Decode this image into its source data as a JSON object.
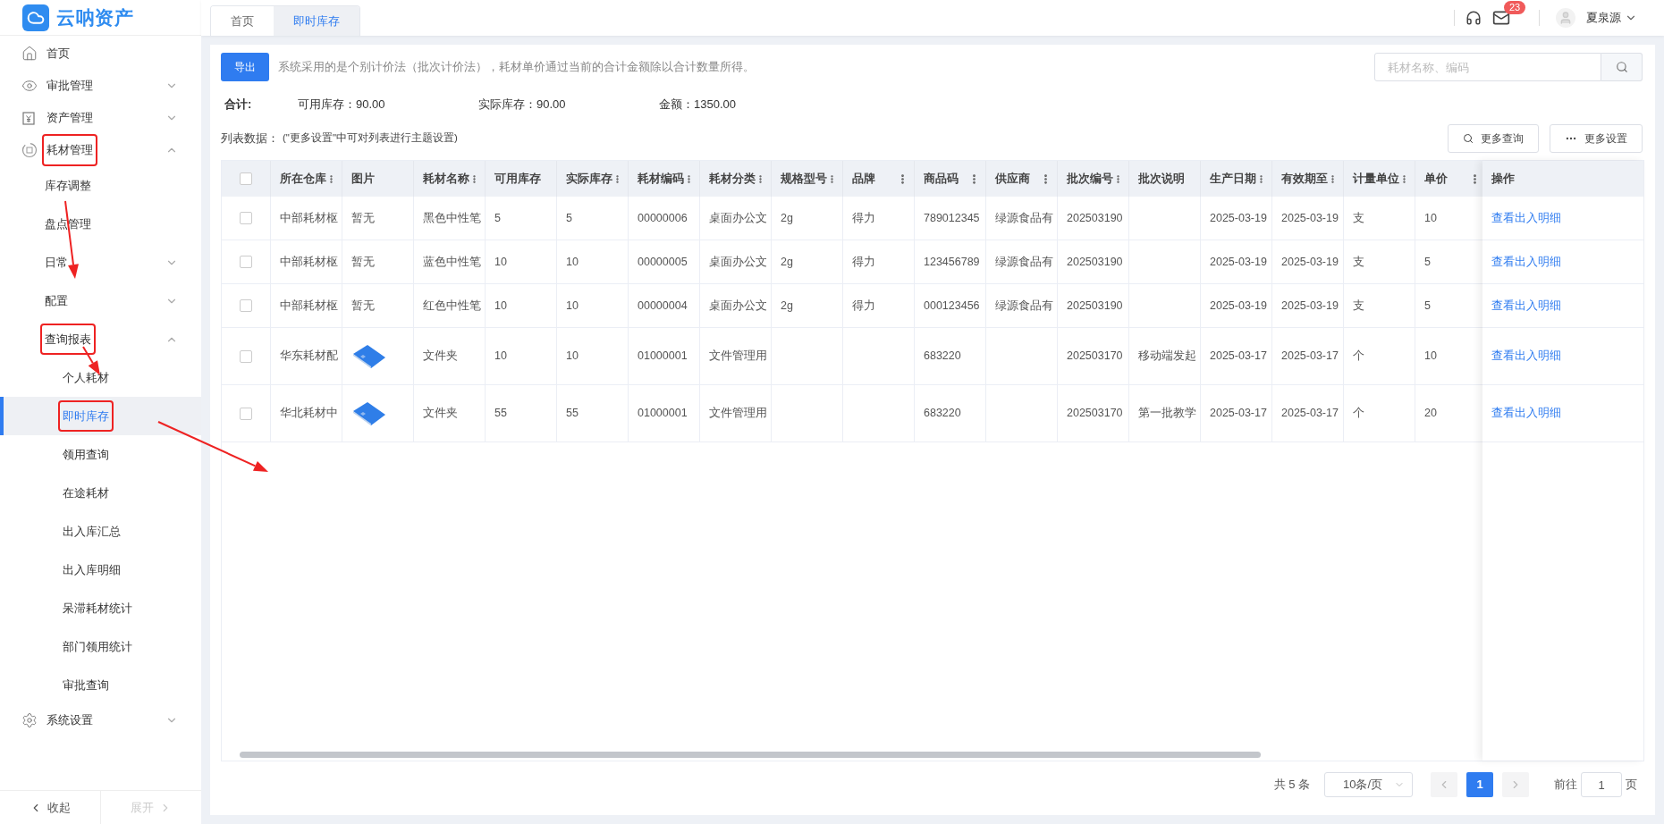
{
  "app": {
    "name": "云呐资产"
  },
  "tabs": [
    {
      "label": "首页",
      "selected": false
    },
    {
      "label": "即时库存",
      "selected": true
    }
  ],
  "header": {
    "notifications": "23",
    "user": "夏泉源"
  },
  "sidebar": {
    "items": [
      {
        "label": "首页",
        "selected": false,
        "annotated": false
      },
      {
        "label": "审批管理",
        "selected": false,
        "annotated": false,
        "expanded": false
      },
      {
        "label": "资产管理",
        "selected": false,
        "annotated": false,
        "expanded": false
      },
      {
        "label": "耗材管理",
        "selected": false,
        "annotated": true,
        "expanded": true,
        "children": [
          {
            "label": "库存调整",
            "selected": false,
            "annotated": false
          },
          {
            "label": "盘点管理",
            "selected": false,
            "annotated": false
          },
          {
            "label": "日常",
            "selected": false,
            "annotated": false,
            "expanded": false
          },
          {
            "label": "配置",
            "selected": false,
            "annotated": false,
            "expanded": false
          },
          {
            "label": "查询报表",
            "selected": false,
            "annotated": true,
            "expanded": true,
            "children": [
              {
                "label": "个人耗材",
                "selected": false,
                "annotated": false
              },
              {
                "label": "即时库存",
                "selected": true,
                "annotated": true
              },
              {
                "label": "领用查询",
                "selected": false,
                "annotated": false
              },
              {
                "label": "在途耗材",
                "selected": false,
                "annotated": false
              },
              {
                "label": "出入库汇总",
                "selected": false,
                "annotated": false
              },
              {
                "label": "出入库明细",
                "selected": false,
                "annotated": false
              },
              {
                "label": "呆滞耗材统计",
                "selected": false,
                "annotated": false
              },
              {
                "label": "部门领用统计",
                "selected": false,
                "annotated": false
              },
              {
                "label": "审批查询",
                "selected": false,
                "annotated": false
              }
            ]
          }
        ]
      },
      {
        "label": "系统设置",
        "selected": false,
        "annotated": false,
        "expanded": false
      }
    ],
    "collapse": {
      "label": "收起",
      "disabled": false
    },
    "expand": {
      "label": "展开",
      "disabled": true
    }
  },
  "toolbar": {
    "export": "导出",
    "note": "系统采用的是个别计价法（批次计价法），耗材单价通过当前的合计金额除以合计数量所得。",
    "search": {
      "placeholder": "耗材名称、编码"
    }
  },
  "summary": {
    "label": "合计:",
    "items": [
      "可用库存：90.00",
      "实际库存：90.00",
      "金额：1350.00"
    ]
  },
  "list": {
    "label": "列表数据：",
    "hint": "(\"更多设置\"中可对列表进行主题设置)",
    "buttons": [
      "更多查询",
      "更多设置"
    ]
  },
  "table": {
    "all_checked": false,
    "columns": [
      {
        "label": "所在仓库",
        "menu": true
      },
      {
        "label": "图片",
        "menu": false
      },
      {
        "label": "耗材名称",
        "menu": true
      },
      {
        "label": "可用库存",
        "menu": false
      },
      {
        "label": "实际库存",
        "menu": true
      },
      {
        "label": "耗材编码",
        "menu": true
      },
      {
        "label": "耗材分类",
        "menu": true
      },
      {
        "label": "规格型号",
        "menu": true
      },
      {
        "label": "品牌",
        "menu": true
      },
      {
        "label": "商品码",
        "menu": true
      },
      {
        "label": "供应商",
        "menu": true
      },
      {
        "label": "批次编号",
        "menu": true
      },
      {
        "label": "批次说明",
        "menu": false
      },
      {
        "label": "生产日期",
        "menu": true
      },
      {
        "label": "有效期至",
        "menu": true
      },
      {
        "label": "计量单位",
        "menu": true
      },
      {
        "label": "单价",
        "menu": true
      }
    ],
    "action_column": "操作",
    "rows": [
      {
        "checked": false,
        "action": "查看出入明细",
        "cells": [
          "中部耗材枢",
          "暂无",
          "黑色中性笔",
          "5",
          "5",
          "00000006",
          "桌面办公文",
          "2g",
          "得力",
          "789012345",
          "绿源食品有",
          "202503190",
          null,
          "2025-03-19",
          "2025-03-19",
          "支",
          "10"
        ]
      },
      {
        "checked": false,
        "action": "查看出入明细",
        "cells": [
          "中部耗材枢",
          "暂无",
          "蓝色中性笔",
          "10",
          "10",
          "00000005",
          "桌面办公文",
          "2g",
          "得力",
          "123456789",
          "绿源食品有",
          "202503190",
          null,
          "2025-03-19",
          "2025-03-19",
          "支",
          "5"
        ]
      },
      {
        "checked": false,
        "action": "查看出入明细",
        "cells": [
          "中部耗材枢",
          "暂无",
          "红色中性笔",
          "10",
          "10",
          "00000004",
          "桌面办公文",
          "2g",
          "得力",
          "000123456",
          "绿源食品有",
          "202503190",
          null,
          "2025-03-19",
          "2025-03-19",
          "支",
          "5"
        ]
      },
      {
        "checked": false,
        "action": "查看出入明细",
        "cells": [
          "华东耗材配",
          {
            "kind": "image"
          },
          "文件夹",
          "10",
          "10",
          "01000001",
          "文件管理用",
          null,
          null,
          "683220",
          null,
          "202503170",
          "移动端发起",
          "2025-03-17",
          "2025-03-17",
          "个",
          "10"
        ]
      },
      {
        "checked": false,
        "action": "查看出入明细",
        "cells": [
          "华北耗材中",
          {
            "kind": "image"
          },
          "文件夹",
          "55",
          "55",
          "01000001",
          "文件管理用",
          null,
          null,
          "683220",
          null,
          "202503170",
          "第一批教学",
          "2025-03-17",
          "2025-03-17",
          "个",
          "20"
        ]
      }
    ]
  },
  "pagination": {
    "total": "共 5 条",
    "page_size": "10条/页",
    "pages": [
      {
        "label": "1",
        "selected": true
      }
    ],
    "goto_label": "前往",
    "goto_value": "1",
    "goto_suffix": "页"
  }
}
